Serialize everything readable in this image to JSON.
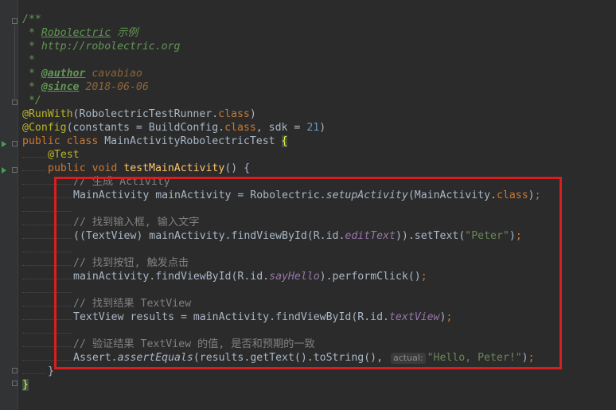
{
  "editor": {
    "line1": "/**",
    "line2_prefix": " * ",
    "line2_link": "Robolectric",
    "line2_rest": " 示例",
    "line3": " * http://robolectric.org",
    "line4": " *",
    "line5_prefix": " * ",
    "line5_tag": "@author",
    "line5_val": " cavabiao",
    "line6_prefix": " * ",
    "line6_tag": "@since",
    "line6_val": " 2018-06-06",
    "line7": " */",
    "line8_annot": "@RunWith",
    "line8_a": "(RobolectricTestRunner.",
    "line8_kw": "class",
    "line8_b": ")",
    "line9_annot": "@Config",
    "line9_a": "(constants = BuildConfig.",
    "line9_kw": "class",
    "line9_b": ", sdk = ",
    "line9_num": "21",
    "line9_c": ")",
    "line10_kw": "public class ",
    "line10_cls": "MainActivityRobolectricTest ",
    "line10_brace": "{",
    "line11_annot": "@Test",
    "line12_kw": "public void ",
    "line12_method": "testMainActivity",
    "line12_rest": "() {",
    "line13_comment": "// 生成 Activity",
    "line14_a": "MainActivity mainActivity = Robolectric.",
    "line14_ital": "setupActivity",
    "line14_b": "(MainActivity.",
    "line14_kw": "class",
    "line14_c": ")",
    "line14_semi": ";",
    "line16_comment": "// 找到输入框, 输入文字",
    "line17_a": "((TextView) mainActivity.findViewById(R.id.",
    "line17_field": "editText",
    "line17_b": ")).setText(",
    "line17_str": "\"Peter\"",
    "line17_c": ")",
    "line17_semi": ";",
    "line19_comment": "// 找到按钮, 触发点击",
    "line20_a": "mainActivity.findViewById(R.id.",
    "line20_field": "sayHello",
    "line20_b": ").performClick()",
    "line20_semi": ";",
    "line22_comment": "// 找到结果 TextView",
    "line23_a": "TextView results = mainActivity.findViewById(R.id.",
    "line23_field": "textView",
    "line23_b": ")",
    "line23_semi": ";",
    "line25_comment": "// 验证结果 TextView 的值, 是否和预期的一致",
    "line26_a": "Assert.",
    "line26_ital": "assertEquals",
    "line26_b": "(results.getText().toString(), ",
    "line26_hint": "actual:",
    "line26_str": "\"Hello, Peter!\"",
    "line26_c": ")",
    "line26_semi": ";",
    "line27": "}",
    "line28": "}"
  },
  "colors": {
    "background": "#2b2b2b",
    "highlight_box": "#d81e1e"
  }
}
